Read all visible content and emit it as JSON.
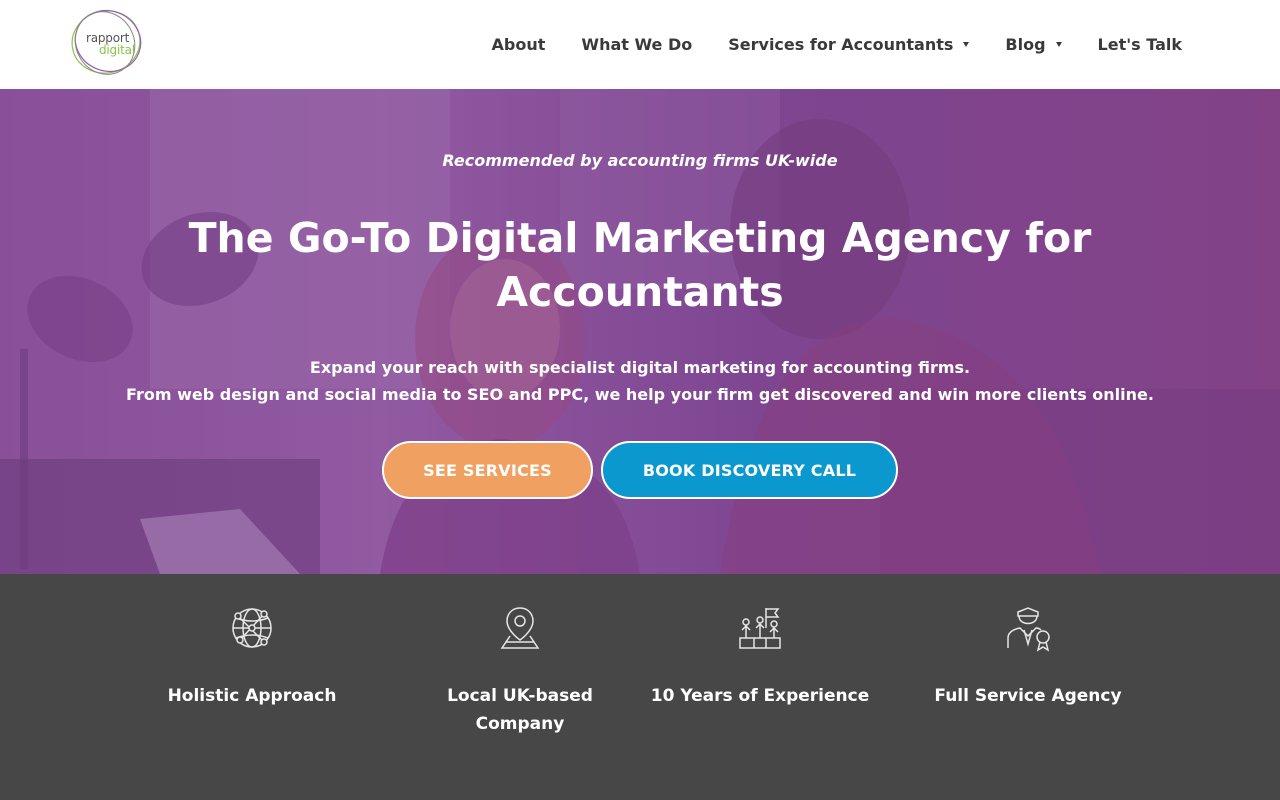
{
  "logo": {
    "line1": "rapport",
    "line2": "digital"
  },
  "nav": {
    "about": "About",
    "what_we_do": "What We Do",
    "services": "Services for Accountants",
    "blog": "Blog",
    "lets_talk": "Let's Talk"
  },
  "hero": {
    "tagline": "Recommended by accounting firms UK-wide",
    "title": "The Go-To Digital Marketing Agency for Accountants",
    "subtitle_line1": "Expand your reach with specialist digital marketing for accounting firms.",
    "subtitle_line2": "From web design and social media to SEO and PPC, we help your firm get discovered and win more clients online.",
    "btn_services": "SEE SERVICES",
    "btn_call": "BOOK DISCOVERY CALL"
  },
  "features": [
    {
      "label": "Holistic Approach",
      "icon": "globe-network-icon"
    },
    {
      "label": "Local UK-based Company",
      "icon": "map-pin-icon"
    },
    {
      "label": "10 Years of Experience",
      "icon": "team-flag-icon"
    },
    {
      "label": "Full Service Agency",
      "icon": "businessman-award-icon"
    }
  ],
  "colors": {
    "hero_overlay": "#803c96",
    "btn_services": "#f0a060",
    "btn_call": "#0b98cf",
    "features_bg": "#474747",
    "logo_green": "#8bc24a",
    "logo_purple": "#9b59b6"
  }
}
